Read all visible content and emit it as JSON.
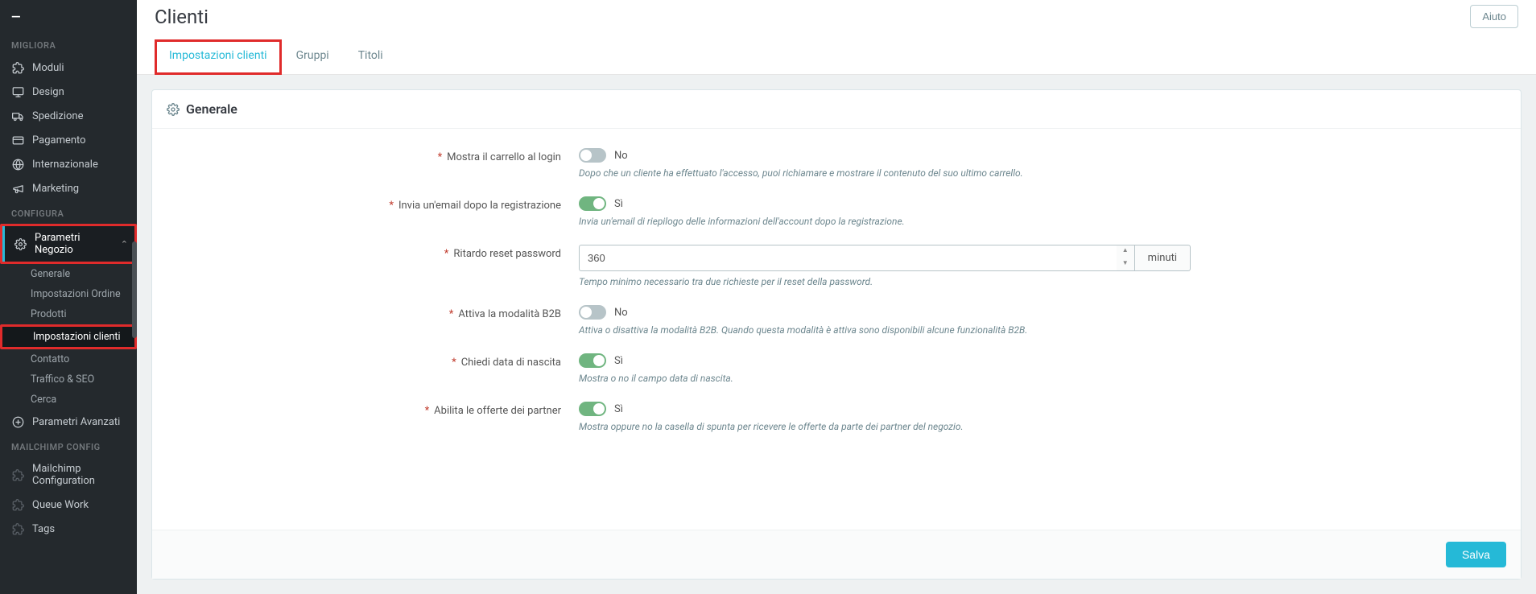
{
  "sidebar": {
    "sections": [
      {
        "title": "MIGLIORA",
        "items": [
          {
            "label": "Moduli",
            "icon": "puzzle"
          },
          {
            "label": "Design",
            "icon": "monitor"
          },
          {
            "label": "Spedizione",
            "icon": "truck"
          },
          {
            "label": "Pagamento",
            "icon": "card"
          },
          {
            "label": "Internazionale",
            "icon": "globe"
          },
          {
            "label": "Marketing",
            "icon": "megaphone"
          }
        ]
      },
      {
        "title": "CONFIGURA",
        "items": [
          {
            "label": "Parametri Negozio",
            "icon": "gear",
            "active": true,
            "expanded": true,
            "children": [
              {
                "label": "Generale"
              },
              {
                "label": "Impostazioni Ordine"
              },
              {
                "label": "Prodotti"
              },
              {
                "label": "Impostazioni clienti",
                "highlight": true
              },
              {
                "label": "Contatto"
              },
              {
                "label": "Traffico & SEO"
              },
              {
                "label": "Cerca"
              }
            ]
          },
          {
            "label": "Parametri Avanzati",
            "icon": "plus-circle"
          }
        ]
      },
      {
        "title": "MAILCHIMP CONFIG",
        "items": [
          {
            "label": "Mailchimp Configuration",
            "icon": "puzzle-dim"
          },
          {
            "label": "Queue Work",
            "icon": "puzzle-dim"
          },
          {
            "label": "Tags",
            "icon": "puzzle-dim"
          }
        ]
      }
    ]
  },
  "header": {
    "title": "Clienti",
    "help": "Aiuto"
  },
  "tabs": [
    {
      "label": "Impostazioni clienti",
      "active": true
    },
    {
      "label": "Gruppi"
    },
    {
      "label": "Titoli"
    }
  ],
  "panel": {
    "title": "Generale",
    "save": "Salva",
    "fields": {
      "cart_login": {
        "label": "Mostra il carrello al login",
        "value": false,
        "text_off": "No",
        "help": "Dopo che un cliente ha effettuato l'accesso, puoi richiamare e mostrare il contenuto del suo ultimo carrello."
      },
      "email_reg": {
        "label": "Invia un'email dopo la registrazione",
        "value": true,
        "text_on": "Sì",
        "help": "Invia un'email di riepilogo delle informazioni dell'account dopo la registrazione."
      },
      "reset_delay": {
        "label": "Ritardo reset password",
        "value": "360",
        "unit": "minuti",
        "help": "Tempo minimo necessario tra due richieste per il reset della password."
      },
      "b2b": {
        "label": "Attiva la modalità B2B",
        "value": false,
        "text_off": "No",
        "help": "Attiva o disattiva la modalità B2B. Quando questa modalità è attiva sono disponibili alcune funzionalità B2B."
      },
      "birthdate": {
        "label": "Chiedi data di nascita",
        "value": true,
        "text_on": "Sì",
        "help": "Mostra o no il campo data di nascita."
      },
      "partner": {
        "label": "Abilita le offerte dei partner",
        "value": true,
        "text_on": "Sì",
        "help": "Mostra oppure no la casella di spunta per ricevere le offerte da parte dei partner del negozio."
      }
    }
  }
}
